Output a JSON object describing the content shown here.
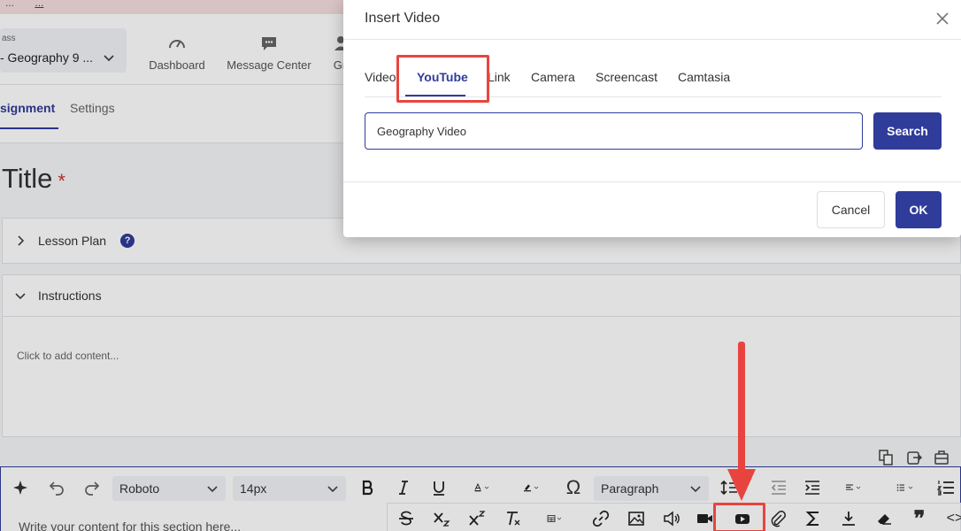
{
  "banner": {
    "text": "...",
    "link": "..."
  },
  "header": {
    "class_label": "ass",
    "class_value": "- Geography 9 ...",
    "nav": [
      {
        "label": "Dashboard"
      },
      {
        "label": "Message Center"
      },
      {
        "label": "Gr"
      }
    ]
  },
  "page_tabs": {
    "assignment": "signment",
    "settings": "Settings"
  },
  "form": {
    "title_label": "Title",
    "required_mark": "*",
    "lesson_plan": "Lesson Plan",
    "help": "?",
    "instructions": "Instructions",
    "instructions_placeholder": "Click to add content..."
  },
  "editor": {
    "font_family": "Roboto",
    "font_size": "14px",
    "block_format": "Paragraph",
    "placeholder": "Write your content for this section here...",
    "omega": "Ω",
    "quote": "❞",
    "code": "<>"
  },
  "modal": {
    "title": "Insert Video",
    "tabs": [
      "Video",
      "YouTube",
      "Link",
      "Camera",
      "Screencast",
      "Camtasia"
    ],
    "active_tab": "YouTube",
    "search_value": "Geography Video",
    "search_label": "Search",
    "cancel_label": "Cancel",
    "ok_label": "OK"
  },
  "colors": {
    "accent": "#2f3c9a",
    "annotation": "#e8443f"
  }
}
